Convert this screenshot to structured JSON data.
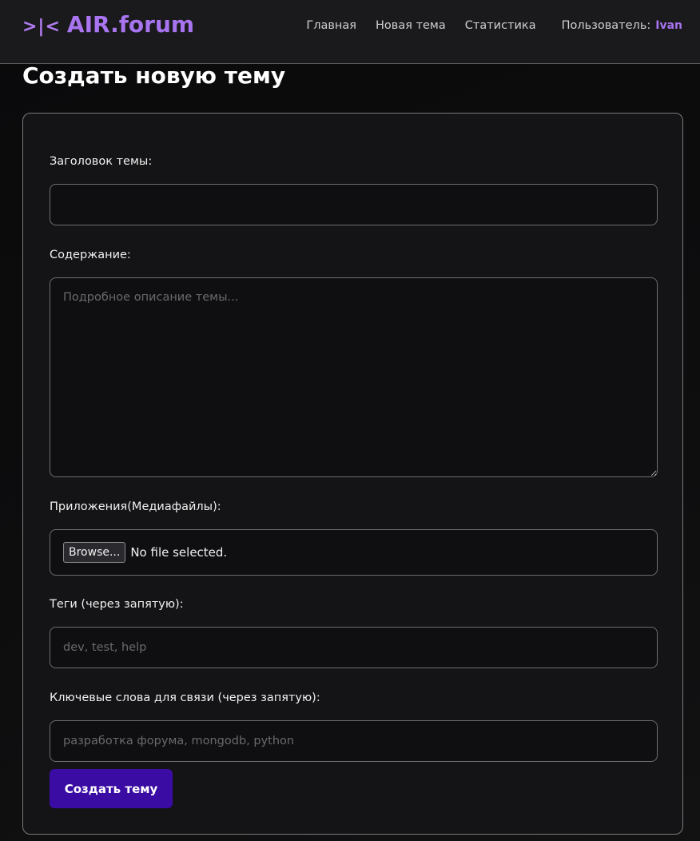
{
  "header": {
    "logo_mark": ">|<",
    "logo_text": "AIR.forum",
    "nav": {
      "home": "Главная",
      "new_topic": "Новая тема",
      "stats": "Статистика",
      "user_label": "Пользователь:",
      "user_name": "Ivan"
    }
  },
  "page": {
    "title": "Создать новую тему"
  },
  "form": {
    "title_label": "Заголовок темы:",
    "title_value": "",
    "content_label": "Содержание:",
    "content_placeholder": "Подробное описание темы...",
    "attachments_label": "Приложения(Медиафайлы):",
    "browse_label": "Browse...",
    "file_status": "No file selected.",
    "tags_label": "Теги (через запятую):",
    "tags_placeholder": "dev, test, help",
    "keywords_label": "Ключевые слова для связи (через запятую):",
    "keywords_placeholder": "разработка форума, mongodb, python",
    "submit_label": "Создать тему"
  },
  "colors": {
    "accent": "#a874f0",
    "button": "#3a0ca3",
    "background": "#0d0d0e",
    "card": "#141416"
  }
}
